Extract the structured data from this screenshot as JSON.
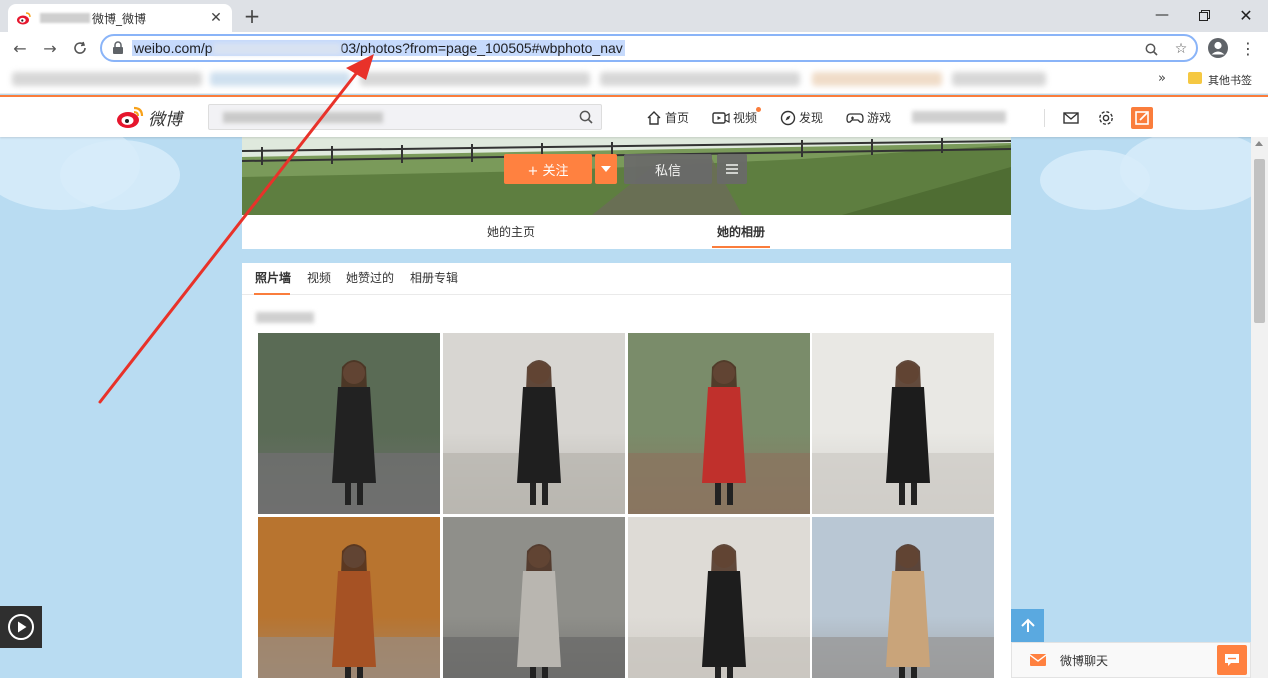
{
  "browser": {
    "tab_title": "微博_微博",
    "url_prefix": "weibo.com/p",
    "url_suffix": "03/photos?from=page_100505#wbphoto_nav",
    "bookmarks_more": "»",
    "bookmarks_folder": "其他书签"
  },
  "weibo_header": {
    "logo_text": "微博",
    "nav": [
      {
        "label": "首页",
        "icon": "home-icon"
      },
      {
        "label": "视频",
        "icon": "video-icon"
      },
      {
        "label": "发现",
        "icon": "discover-icon"
      },
      {
        "label": "游戏",
        "icon": "game-icon"
      }
    ]
  },
  "profile": {
    "follow_label": "+ 关注",
    "message_label": "私信",
    "tabs": [
      {
        "label": "她的主页",
        "active": false
      },
      {
        "label": "她的相册",
        "active": true
      }
    ]
  },
  "album": {
    "subtabs": [
      {
        "label": "照片墙",
        "active": true
      },
      {
        "label": "视频",
        "active": false
      },
      {
        "label": "她赞过的",
        "active": false
      },
      {
        "label": "相册专辑",
        "active": false
      }
    ],
    "photos": [
      {
        "bg": "#5a6b55",
        "ground": "#6f6f6f",
        "coat": "#222222"
      },
      {
        "bg": "#d8d6d2",
        "ground": "#b9b6b0",
        "coat": "#1f1f1f"
      },
      {
        "bg": "#7a8c6a",
        "ground": "#8a7560",
        "coat": "#c0302c"
      },
      {
        "bg": "#e9e8e4",
        "ground": "#cfcdc8",
        "coat": "#1c1c1c"
      },
      {
        "bg": "#b8742f",
        "ground": "#9c8a78",
        "coat": "#a65224"
      },
      {
        "bg": "#8f8f8a",
        "ground": "#6c6c6a",
        "coat": "#b9b6b0"
      },
      {
        "bg": "#dedbd6",
        "ground": "#c9c5bf",
        "coat": "#1d1d1d"
      },
      {
        "bg": "#b9c7d4",
        "ground": "#9a9a9a",
        "coat": "#c9a47a"
      }
    ]
  },
  "chat": {
    "label": "微博聊天"
  },
  "colors": {
    "accent": "#fa7d3c",
    "follow_button": "#ff8140",
    "page_bg": "#b9dcf2",
    "annotation_arrow": "#e8322a"
  }
}
